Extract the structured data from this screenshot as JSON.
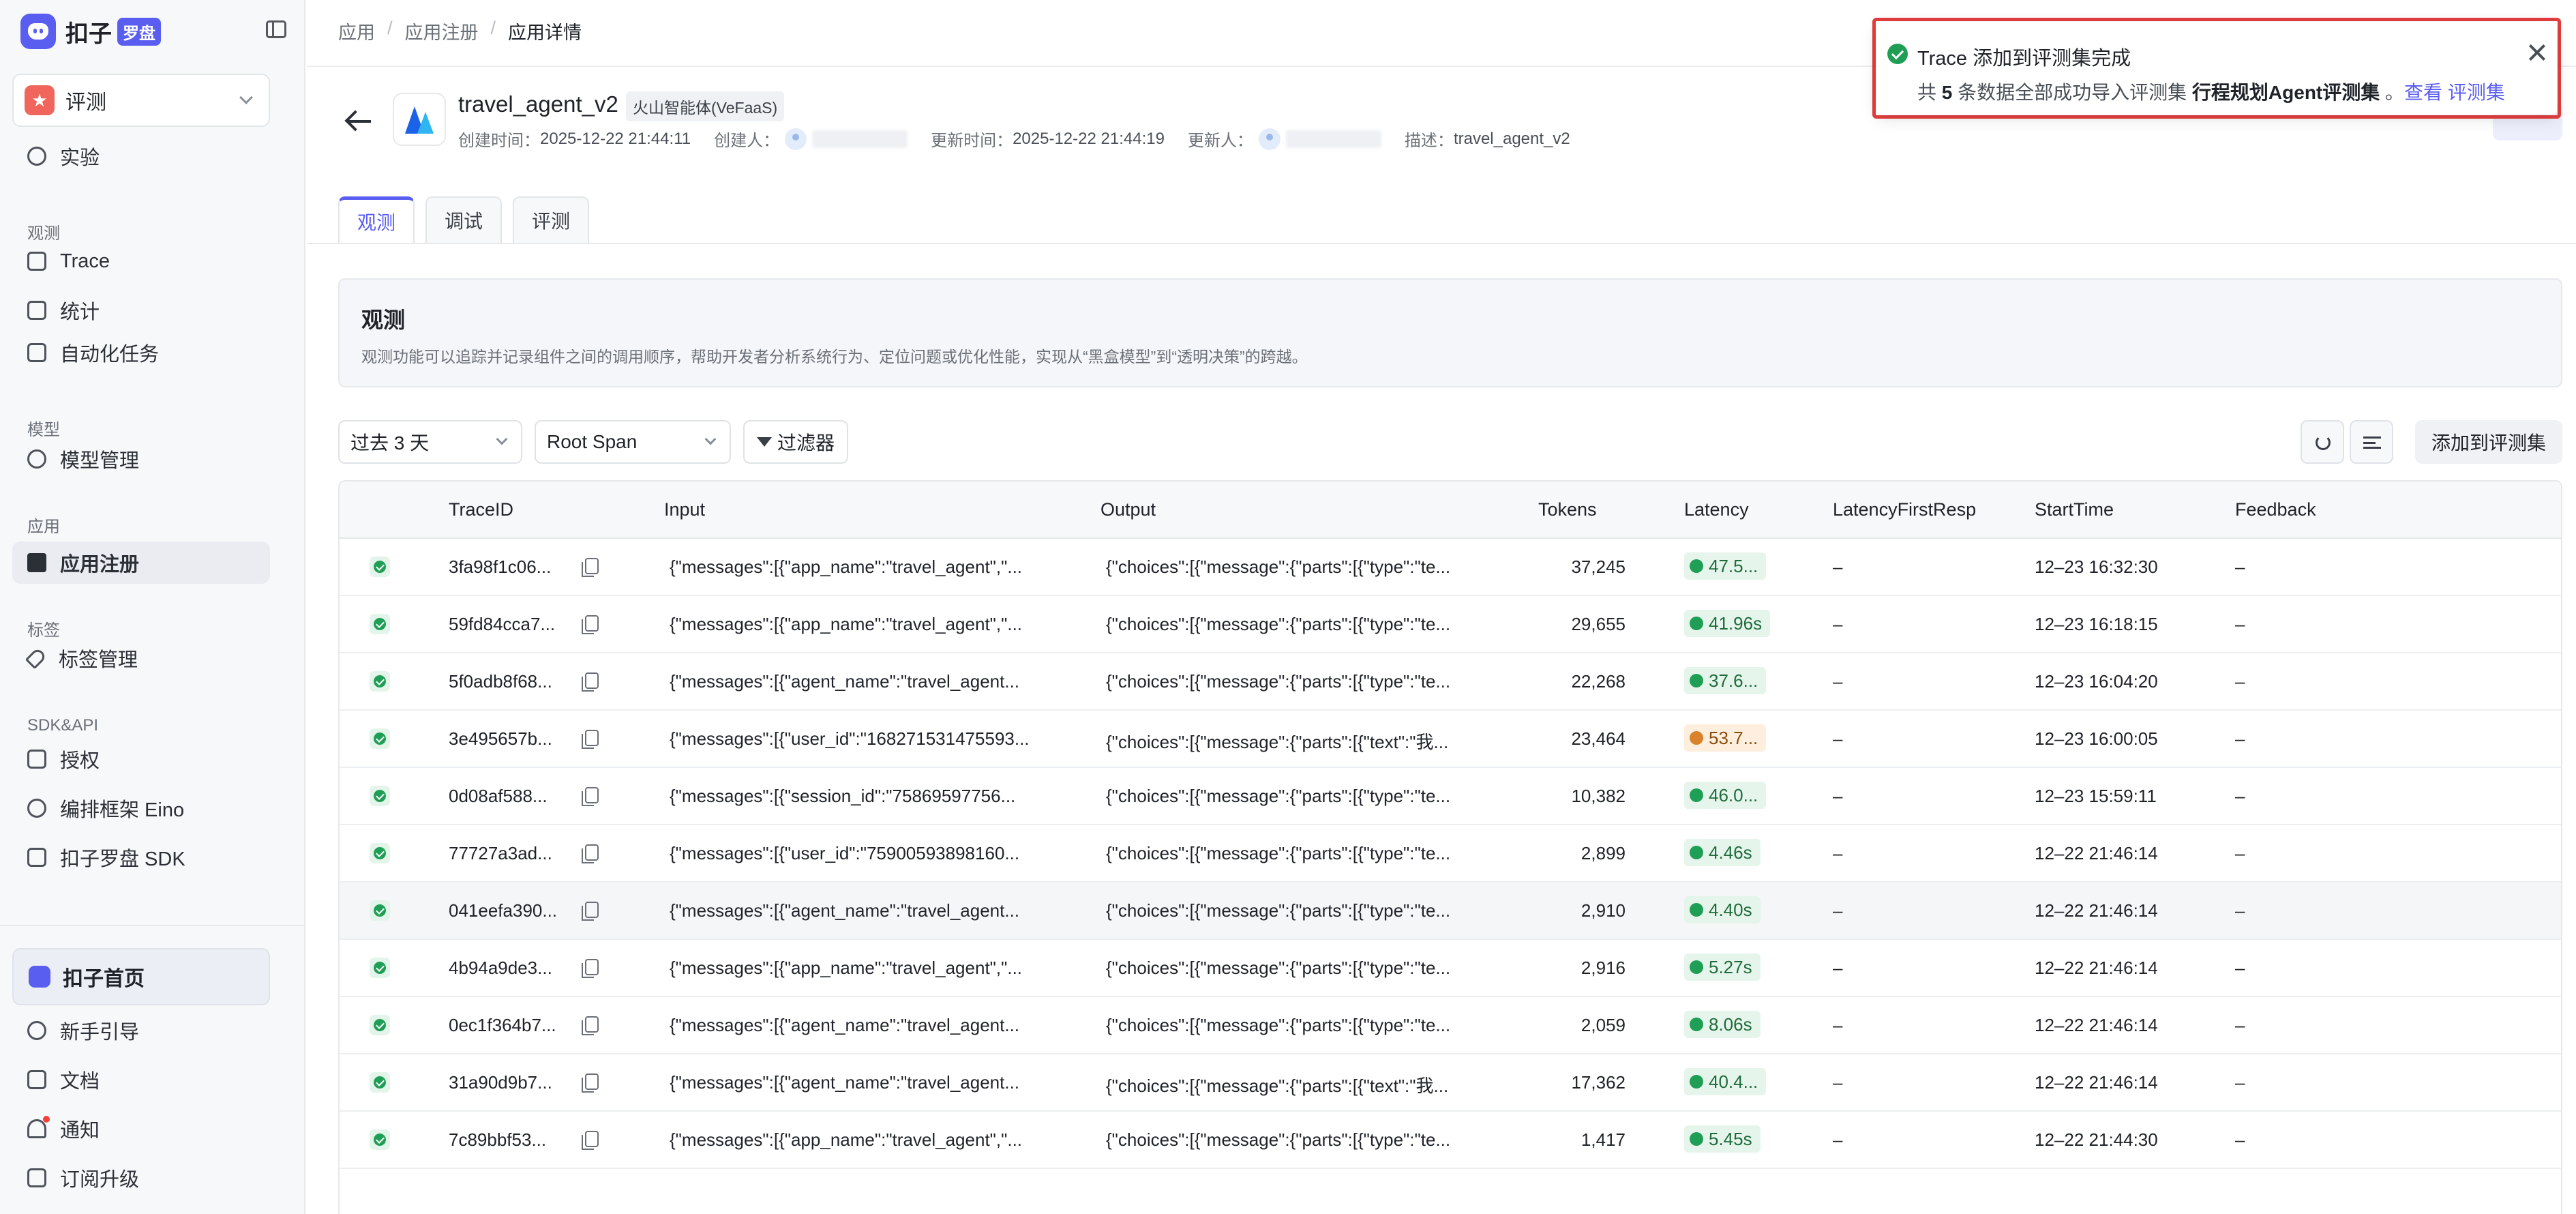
{
  "sidebar": {
    "logo_text": "扣子",
    "logo_badge": "罗盘",
    "space": {
      "avatar": "★",
      "label": "评测"
    },
    "nav": [
      {
        "type": "item",
        "label": "实验",
        "icon": "flask-icon"
      },
      {
        "type": "section",
        "label": "观测"
      },
      {
        "type": "item",
        "label": "Trace",
        "icon": "trace-icon"
      },
      {
        "type": "item",
        "label": "统计",
        "icon": "chart-icon"
      },
      {
        "type": "item",
        "label": "自动化任务",
        "icon": "task-icon"
      },
      {
        "type": "section",
        "label": "模型"
      },
      {
        "type": "item",
        "label": "模型管理",
        "icon": "model-icon"
      },
      {
        "type": "section",
        "label": "应用"
      },
      {
        "type": "item",
        "label": "应用注册",
        "icon": "cube-icon",
        "active": true
      },
      {
        "type": "section",
        "label": "标签"
      },
      {
        "type": "item",
        "label": "标签管理",
        "icon": "tag-icon"
      },
      {
        "type": "section",
        "label": "SDK&API"
      },
      {
        "type": "item",
        "label": "授权",
        "icon": "key-icon"
      },
      {
        "type": "item",
        "label": "编排框架 Eino",
        "icon": "gear-icon"
      },
      {
        "type": "item",
        "label": "扣子罗盘 SDK",
        "icon": "link-icon"
      }
    ],
    "home": "扣子首页",
    "bottom": [
      {
        "label": "新手引导",
        "icon": "help-icon"
      },
      {
        "label": "文档",
        "icon": "doc-icon"
      },
      {
        "label": "通知",
        "icon": "bell-icon"
      },
      {
        "label": "订阅升级",
        "icon": "upgrade-icon"
      }
    ]
  },
  "breadcrumb": [
    "应用",
    "应用注册",
    "应用详情"
  ],
  "app": {
    "name": "travel_agent_v2",
    "tag": "火山智能体(VeFaaS)",
    "created_label": "创建时间：",
    "created": "2025-12-22 21:44:11",
    "creator_label": "创建人：",
    "updated_label": "更新时间：",
    "updated": "2025-12-22 21:44:19",
    "updater_label": "更新人：",
    "desc_label": "描述：",
    "desc": "travel_agent_v2"
  },
  "tabs": [
    "观测",
    "调试",
    "评测"
  ],
  "info": {
    "title": "观测",
    "desc": "观测功能可以追踪并记录组件之间的调用顺序，帮助开发者分析系统行为、定位问题或优化性能，实现从“黑盒模型”到“透明决策”的跨越。"
  },
  "filters": {
    "time": "过去 3 天",
    "span": "Root Span",
    "filter_btn": "过滤器",
    "add_btn": "添加到评测集"
  },
  "table": {
    "columns": [
      "TraceID",
      "Input",
      "Output",
      "Tokens",
      "Latency",
      "LatencyFirstResp",
      "StartTime",
      "Feedback"
    ],
    "rows": [
      {
        "id": "3fa98f1c06...",
        "input": "{\"messages\":[{\"app_name\":\"travel_agent\",\"...",
        "output": "{\"choices\":[{\"message\":{\"parts\":[{\"type\":\"te...",
        "tokens": "37,245",
        "latency": "47.5...",
        "lat_status": "green",
        "first": "–",
        "start": "12–23 16:32:30",
        "feedback": "–"
      },
      {
        "id": "59fd84cca7...",
        "input": "{\"messages\":[{\"app_name\":\"travel_agent\",\"...",
        "output": "{\"choices\":[{\"message\":{\"parts\":[{\"type\":\"te...",
        "tokens": "29,655",
        "latency": "41.96s",
        "lat_status": "green",
        "first": "–",
        "start": "12–23 16:18:15",
        "feedback": "–"
      },
      {
        "id": "5f0adb8f68...",
        "input": "{\"messages\":[{\"agent_name\":\"travel_agent...",
        "output": "{\"choices\":[{\"message\":{\"parts\":[{\"type\":\"te...",
        "tokens": "22,268",
        "latency": "37.6...",
        "lat_status": "green",
        "first": "–",
        "start": "12–23 16:04:20",
        "feedback": "–"
      },
      {
        "id": "3e495657b...",
        "input": "{\"messages\":[{\"user_id\":\"168271531475593...",
        "output": "{\"choices\":[{\"message\":{\"parts\":[{\"text\":\"我...",
        "tokens": "23,464",
        "latency": "53.7...",
        "lat_status": "orange",
        "first": "–",
        "start": "12–23 16:00:05",
        "feedback": "–"
      },
      {
        "id": "0d08af588...",
        "input": "{\"messages\":[{\"session_id\":\"75869597756...",
        "output": "{\"choices\":[{\"message\":{\"parts\":[{\"type\":\"te...",
        "tokens": "10,382",
        "latency": "46.0...",
        "lat_status": "green",
        "first": "–",
        "start": "12–23 15:59:11",
        "feedback": "–"
      },
      {
        "id": "77727a3ad...",
        "input": "{\"messages\":[{\"user_id\":\"75900593898160...",
        "output": "{\"choices\":[{\"message\":{\"parts\":[{\"type\":\"te...",
        "tokens": "2,899",
        "latency": "4.46s",
        "lat_status": "green",
        "first": "–",
        "start": "12–22 21:46:14",
        "feedback": "–"
      },
      {
        "id": "041eefa390...",
        "input": "{\"messages\":[{\"agent_name\":\"travel_agent...",
        "output": "{\"choices\":[{\"message\":{\"parts\":[{\"type\":\"te...",
        "tokens": "2,910",
        "latency": "4.40s",
        "lat_status": "green",
        "first": "–",
        "start": "12–22 21:46:14",
        "feedback": "–"
      },
      {
        "id": "4b94a9de3...",
        "input": "{\"messages\":[{\"app_name\":\"travel_agent\",\"...",
        "output": "{\"choices\":[{\"message\":{\"parts\":[{\"type\":\"te...",
        "tokens": "2,916",
        "latency": "5.27s",
        "lat_status": "green",
        "first": "–",
        "start": "12–22 21:46:14",
        "feedback": "–"
      },
      {
        "id": "0ec1f364b7...",
        "input": "{\"messages\":[{\"agent_name\":\"travel_agent...",
        "output": "{\"choices\":[{\"message\":{\"parts\":[{\"type\":\"te...",
        "tokens": "2,059",
        "latency": "8.06s",
        "lat_status": "green",
        "first": "–",
        "start": "12–22 21:46:14",
        "feedback": "–"
      },
      {
        "id": "31a90d9b7...",
        "input": "{\"messages\":[{\"agent_name\":\"travel_agent...",
        "output": "{\"choices\":[{\"message\":{\"parts\":[{\"text\":\"我...",
        "tokens": "17,362",
        "latency": "40.4...",
        "lat_status": "green",
        "first": "–",
        "start": "12–22 21:46:14",
        "feedback": "–"
      },
      {
        "id": "7c89bbf53...",
        "input": "{\"messages\":[{\"app_name\":\"travel_agent\",\"...",
        "output": "{\"choices\":[{\"message\":{\"parts\":[{\"type\":\"te...",
        "tokens": "1,417",
        "latency": "5.45s",
        "lat_status": "green",
        "first": "–",
        "start": "12–22 21:44:30",
        "feedback": "–"
      }
    ]
  },
  "toast": {
    "title": "Trace 添加到评测集完成",
    "body_prefix": "共 ",
    "count": "5",
    "body_mid": " 条数据全部成功导入评测集 ",
    "dataset": "行程规划Agent评测集",
    "body_sep": " 。",
    "link_view": "查看",
    "link_dataset": "评测集"
  }
}
